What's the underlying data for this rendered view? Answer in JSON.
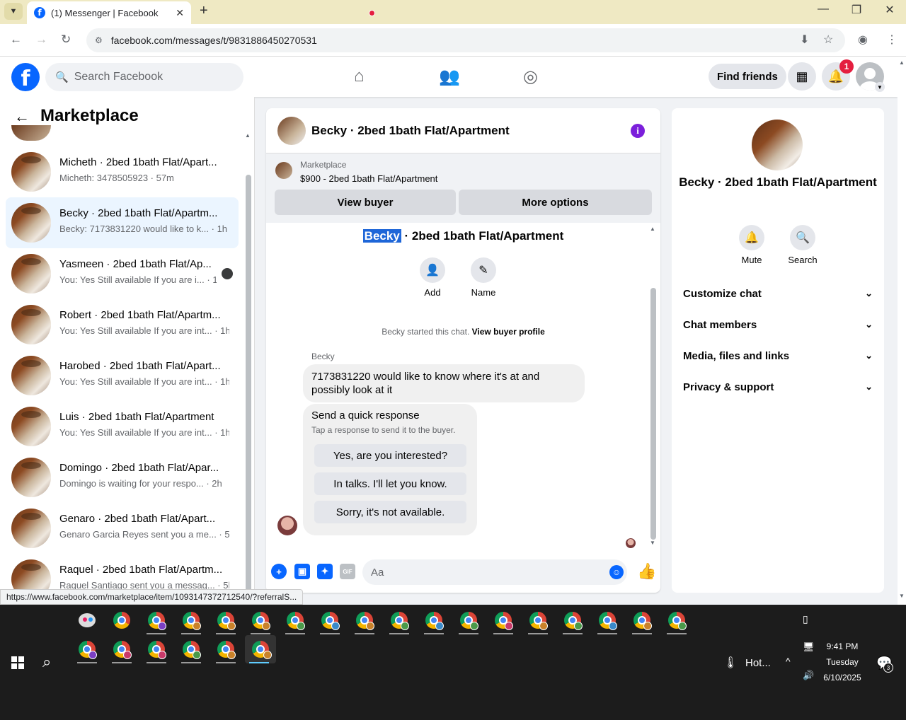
{
  "browser": {
    "tab_title": "(1) Messenger | Facebook",
    "url": "facebook.com/messages/t/9831886450270531",
    "status_url": "https://www.facebook.com/marketplace/item/1093147372712540/?referralS..."
  },
  "fb_header": {
    "search_placeholder": "Search Facebook",
    "find_friends": "Find friends",
    "notification_count": "1"
  },
  "sidebar": {
    "title": "Marketplace",
    "conversations": [
      {
        "name": "Micheth · 2bed 1bath Flat/Apart...",
        "snippet": "Micheth: 3478505923 · 57m",
        "active": false
      },
      {
        "name": "Becky · 2bed 1bath Flat/Apartm...",
        "snippet": "Becky: 7173831220 would like to k... · 1h",
        "active": true
      },
      {
        "name": "Yasmeen · 2bed 1bath Flat/Ap...",
        "snippet": "You: Yes Still available If you are i... · 1h",
        "active": false
      },
      {
        "name": "Robert · 2bed 1bath Flat/Apartm...",
        "snippet": "You: Yes Still available If you are int... · 1h",
        "active": false
      },
      {
        "name": "Harobed · 2bed 1bath Flat/Apart...",
        "snippet": "You: Yes Still available If you are int... · 1h",
        "active": false
      },
      {
        "name": "Luis · 2bed 1bath Flat/Apartment",
        "snippet": "You: Yes Still available If you are int... · 1h",
        "active": false
      },
      {
        "name": "Domingo · 2bed 1bath Flat/Apar...",
        "snippet": "Domingo is waiting for your respo... · 2h",
        "active": false
      },
      {
        "name": "Genaro · 2bed 1bath Flat/Apart...",
        "snippet": "Genaro Garcia Reyes sent you a me... · 5h",
        "active": false
      },
      {
        "name": "Raquel · 2bed 1bath Flat/Apartm...",
        "snippet": "Raquel Santiago sent you a messag... · 5h",
        "active": false
      }
    ]
  },
  "chat": {
    "title": "Becky · 2bed 1bath Flat/Apartment",
    "marketplace_label": "Marketplace",
    "listing": "$900 - 2bed 1bath Flat/Apartment",
    "view_buyer": "View buyer",
    "more_options": "More options",
    "body_title_selected": "Becky",
    "body_title_rest": " · 2bed 1bath Flat/Apartment",
    "add_label": "Add",
    "name_label": "Name",
    "started_text": "Becky started this chat.",
    "view_buyer_profile": "View buyer profile",
    "sender": "Becky",
    "message": "7173831220 would like to know where it's at and possibly look at it",
    "quick_title": "Send a quick response",
    "quick_sub": "Tap a response to send it to the buyer.",
    "quick_responses": [
      "Yes, are you interested?",
      "In talks. I'll let you know.",
      "Sorry, it's not available."
    ],
    "composer_placeholder": "Aa",
    "gif_label": "GIF"
  },
  "info_panel": {
    "name": "Becky · 2bed 1bath Flat/Apartment",
    "mute": "Mute",
    "search": "Search",
    "sections": [
      "Customize chat",
      "Chat members",
      "Media, files and links",
      "Privacy & support"
    ]
  },
  "taskbar": {
    "weather": "Hot...",
    "time": "9:41 PM",
    "day": "Tuesday",
    "date": "6/10/2025",
    "notification_count": "3"
  },
  "colors": {
    "fb_blue": "#0866ff",
    "active_row": "#ebf5ff",
    "info_purple": "#7b1fdb",
    "badge_red": "#e41e3f"
  }
}
